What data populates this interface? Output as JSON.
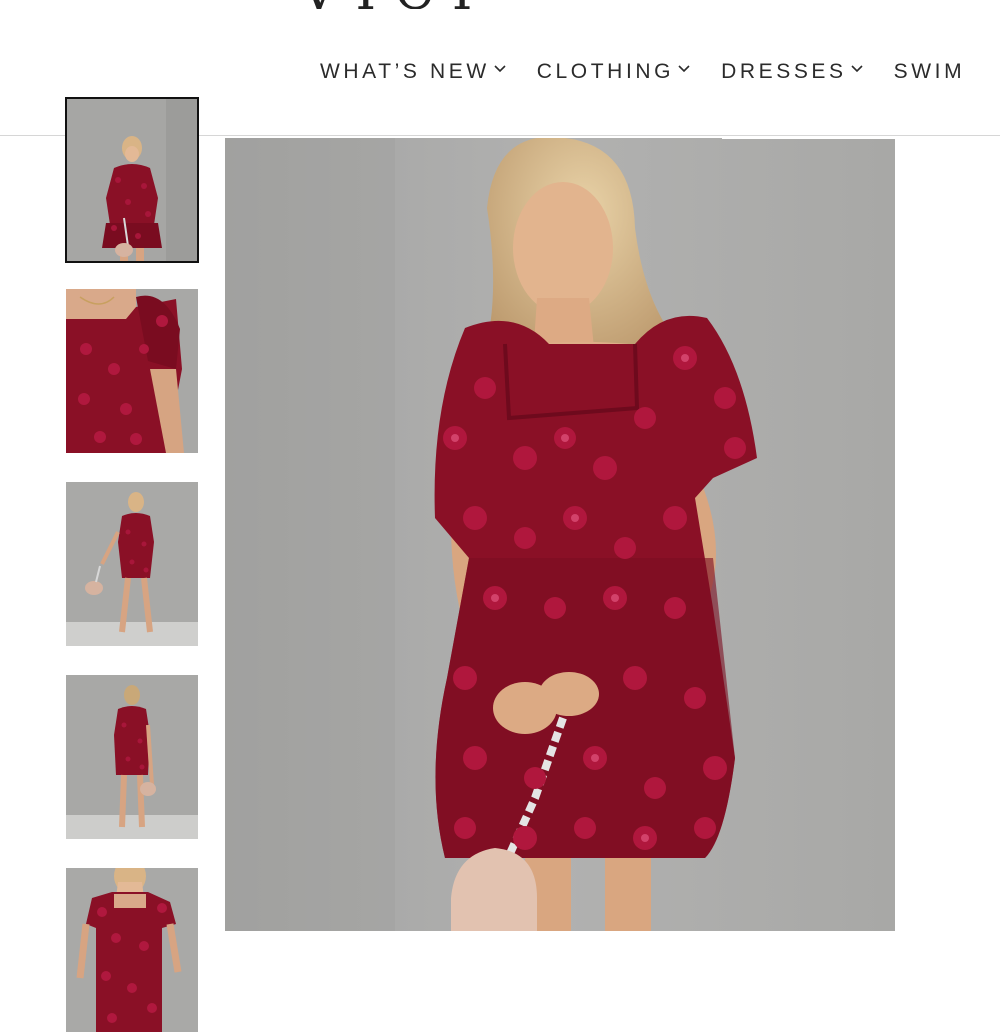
{
  "header": {
    "logo_text": "VICI",
    "nav": [
      {
        "label": "WHAT’S NEW",
        "icon": "chevron-down-icon"
      },
      {
        "label": "CLOTHING",
        "icon": "chevron-down-icon"
      },
      {
        "label": "DRESSES",
        "icon": "chevron-down-icon"
      },
      {
        "label": "SWIM",
        "icon": "chevron-down-icon"
      }
    ]
  },
  "gallery": {
    "active_thumbnail": 0,
    "thumbnails": [
      {
        "view": "full-front"
      },
      {
        "view": "close-up-bodice"
      },
      {
        "view": "full-walking"
      },
      {
        "view": "full-back"
      },
      {
        "view": "close-up-front"
      }
    ]
  },
  "colors": {
    "dress": "#8a1026",
    "flower": "#a8163a",
    "wall": "#a9a9a8",
    "nav_text": "#2b2b2b"
  }
}
